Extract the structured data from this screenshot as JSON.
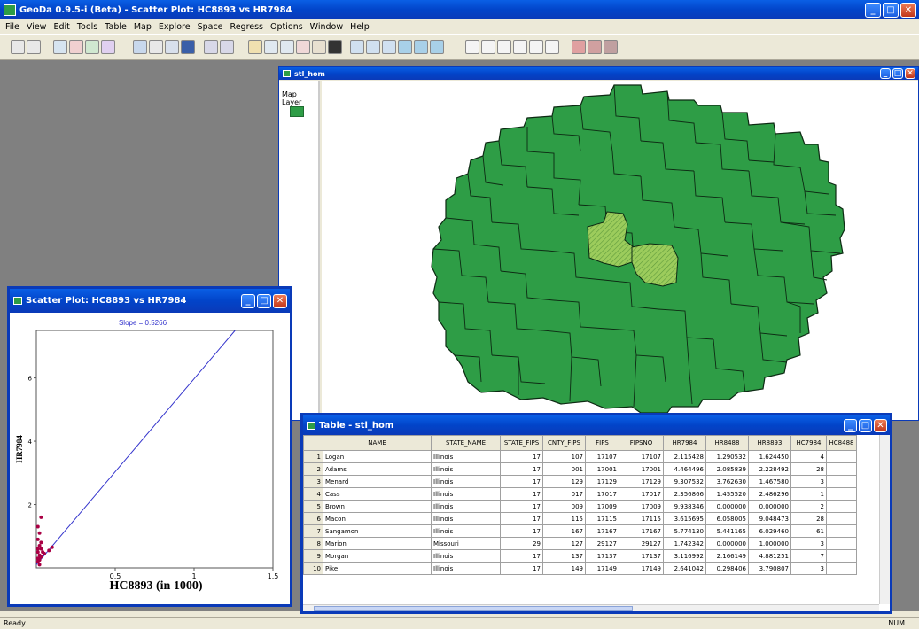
{
  "app": {
    "title": "GeoDa 0.9.5-i (Beta) - Scatter Plot: HC8893 vs HR7984"
  },
  "menu": [
    "File",
    "View",
    "Edit",
    "Tools",
    "Table",
    "Map",
    "Explore",
    "Space",
    "Regress",
    "Options",
    "Window",
    "Help"
  ],
  "map_window": {
    "title": "stl_hom",
    "legend_title": "Map Layer",
    "fill_color": "#2e9d46",
    "selected_color": "#9ccc5c"
  },
  "scatter_window": {
    "title": "Scatter Plot: HC8893 vs HR7984",
    "chart_data": {
      "type": "scatter",
      "title": "Slope = 0.5266",
      "xlabel": "HC8893 (in 1000)",
      "ylabel": "HR7984",
      "x_ticks": [
        "0.5",
        "1",
        "1.5"
      ],
      "y_ticks": [
        "6",
        "4",
        "2"
      ],
      "xlim": [
        0,
        1.5
      ],
      "ylim": [
        0,
        7.5
      ],
      "points": [
        [
          0.01,
          0.3
        ],
        [
          0.01,
          0.5
        ],
        [
          0.02,
          0.7
        ],
        [
          0.01,
          0.9
        ],
        [
          0.02,
          1.1
        ],
        [
          0.03,
          0.6
        ],
        [
          0.01,
          0.2
        ],
        [
          0.02,
          0.4
        ],
        [
          0.03,
          0.8
        ],
        [
          0.01,
          1.3
        ],
        [
          0.02,
          0.3
        ],
        [
          0.04,
          0.5
        ],
        [
          0.01,
          0.6
        ],
        [
          0.03,
          0.35
        ],
        [
          0.05,
          0.45
        ],
        [
          0.02,
          0.25
        ],
        [
          0.08,
          0.55
        ],
        [
          0.1,
          0.65
        ],
        [
          0.03,
          1.6
        ],
        [
          0.02,
          0.1
        ]
      ],
      "fit_line": {
        "slope": 0.5266,
        "intercept": 0.1
      },
      "point_color": "#aa0044",
      "line_color": "#3333cc"
    }
  },
  "table_window": {
    "title": "Table - stl_hom",
    "columns": [
      "NAME",
      "STATE_NAME",
      "STATE_FIPS",
      "CNTY_FIPS",
      "FIPS",
      "FIPSNO",
      "HR7984",
      "HR8488",
      "HR8893",
      "HC7984",
      "HC8488"
    ],
    "rows": [
      [
        "1",
        "Logan",
        "Illinois",
        "17",
        "107",
        "17107",
        "17107",
        "2.115428",
        "1.290532",
        "1.624450",
        "4",
        ""
      ],
      [
        "2",
        "Adams",
        "Illinois",
        "17",
        "001",
        "17001",
        "17001",
        "4.464496",
        "2.085839",
        "2.228492",
        "28",
        ""
      ],
      [
        "3",
        "Menard",
        "Illinois",
        "17",
        "129",
        "17129",
        "17129",
        "9.307532",
        "3.762630",
        "1.467580",
        "3",
        ""
      ],
      [
        "4",
        "Cass",
        "Illinois",
        "17",
        "017",
        "17017",
        "17017",
        "2.356866",
        "1.455520",
        "2.486296",
        "1",
        ""
      ],
      [
        "5",
        "Brown",
        "Illinois",
        "17",
        "009",
        "17009",
        "17009",
        "9.938346",
        "0.000000",
        "0.000000",
        "2",
        ""
      ],
      [
        "6",
        "Macon",
        "Illinois",
        "17",
        "115",
        "17115",
        "17115",
        "3.615695",
        "6.058005",
        "9.048473",
        "28",
        ""
      ],
      [
        "7",
        "Sangamon",
        "Illinois",
        "17",
        "167",
        "17167",
        "17167",
        "5.774130",
        "5.441165",
        "6.029460",
        "61",
        ""
      ],
      [
        "8",
        "Marion",
        "Missouri",
        "29",
        "127",
        "29127",
        "29127",
        "1.742342",
        "0.000000",
        "1.000000",
        "3",
        ""
      ],
      [
        "9",
        "Morgan",
        "Illinois",
        "17",
        "137",
        "17137",
        "17137",
        "3.116992",
        "2.166149",
        "4.881251",
        "7",
        ""
      ],
      [
        "10",
        "Pike",
        "Illinois",
        "17",
        "149",
        "17149",
        "17149",
        "2.641042",
        "0.298406",
        "3.790807",
        "3",
        ""
      ]
    ]
  },
  "status": {
    "left": "Ready",
    "right": "NUM"
  }
}
